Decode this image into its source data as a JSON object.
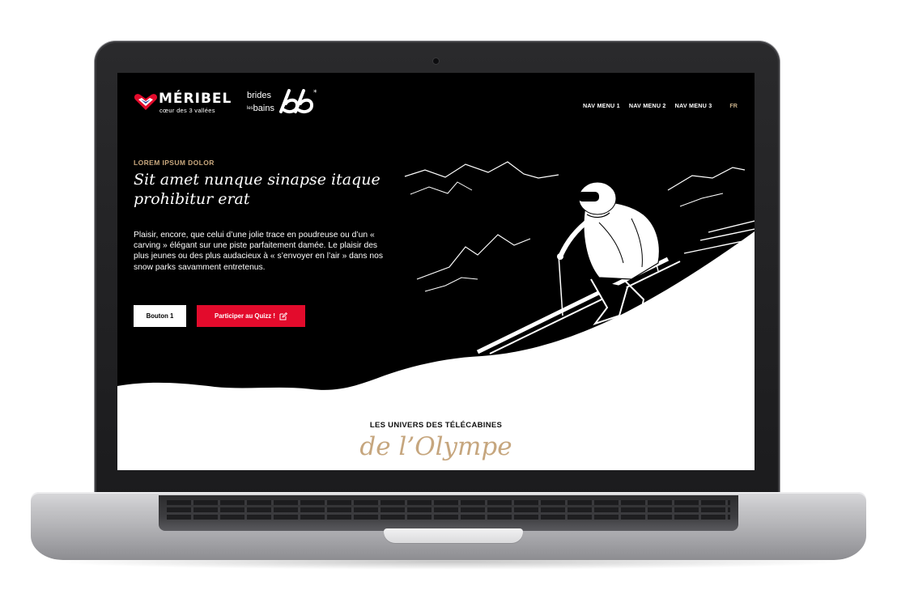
{
  "header": {
    "brand1": {
      "name": "MÉRIBEL",
      "tagline": "cœur des 3 vallées"
    },
    "brand2": {
      "line1": "brides",
      "line2_prefix": "les",
      "line2": "bains"
    },
    "nav": [
      "NAV MENU 1",
      "NAV MENU 2",
      "NAV MENU 3"
    ],
    "lang": "FR"
  },
  "hero": {
    "eyebrow": "LOREM IPSUM DOLOR",
    "title": "Sit amet nunque sinapse itaque prohibitur erat",
    "body": "Plaisir, encore, que celui d’une jolie trace en poudreuse ou d’un « carving » élégant sur une piste parfaitement damée. Le plaisir des plus jeunes ou des plus audacieux à « s’envoyer en l’air » dans nos snow parks savamment entretenus.",
    "button_primary": "Bouton 1",
    "button_quiz": "Participer au Quizz !",
    "button_quiz_icon": "edit-icon"
  },
  "section": {
    "kicker": "LES UNIVERS DES TÉLÉCABINES",
    "script": "de l’Olympe"
  },
  "colors": {
    "accent_red": "#e30b2c",
    "gold": "#c9a87e",
    "hero_bg": "#000000"
  }
}
